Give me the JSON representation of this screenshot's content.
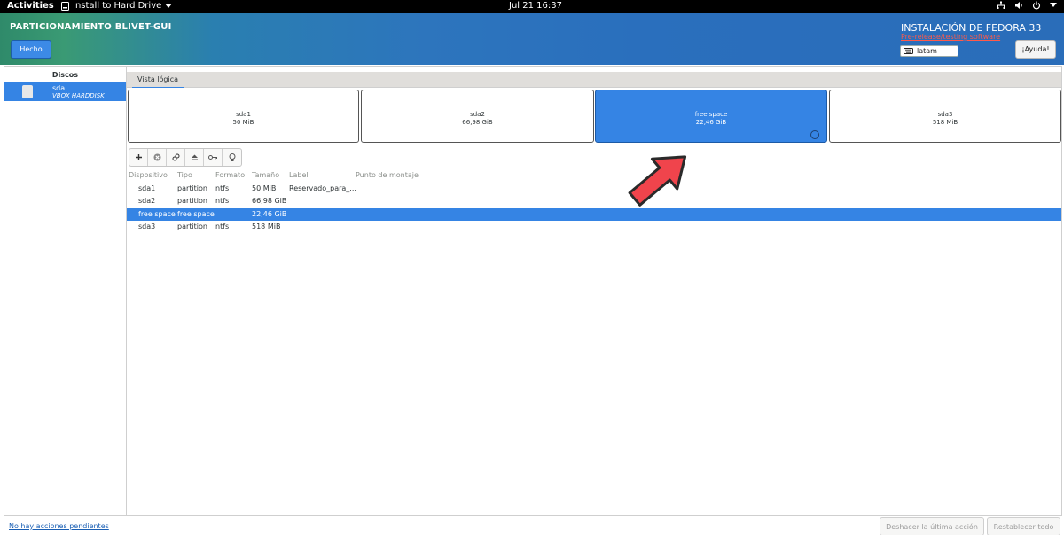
{
  "topbar": {
    "activities": "Activities",
    "app_menu": "Install to Hard Drive",
    "clock": "Jul 21  16:37"
  },
  "header": {
    "title": "PARTICIONAMIENTO BLIVET-GUI",
    "done_label": "Hecho",
    "install_title": "INSTALACIÓN DE FEDORA 33",
    "warning": "Pre-release/testing software",
    "keyboard": "latam",
    "help_label": "¡Ayuda!"
  },
  "disks": {
    "header": "Discos",
    "items": [
      {
        "name": "sda",
        "model": "VBOX HARDDISK"
      }
    ]
  },
  "view": {
    "tab_label": "Vista lógica",
    "blocks": [
      {
        "name": "sda1",
        "size": "50 MiB",
        "selected": false
      },
      {
        "name": "sda2",
        "size": "66,98 GiB",
        "selected": false
      },
      {
        "name": "free space",
        "size": "22,46 GiB",
        "selected": true
      },
      {
        "name": "sda3",
        "size": "518 MiB",
        "selected": false
      }
    ]
  },
  "toolbar": {
    "icons": [
      "add-icon",
      "delete-icon",
      "edit-icon",
      "unmount-icon",
      "decrypt-icon",
      "info-icon"
    ]
  },
  "table": {
    "columns": [
      "Dispositivo",
      "Tipo",
      "Formato",
      "Tamaño",
      "Label",
      "Punto de montaje"
    ],
    "rows": [
      {
        "device": "sda1",
        "type": "partition",
        "format": "ntfs",
        "size": "50 MiB",
        "label": "Reservado_para_...",
        "mount": "",
        "selected": false
      },
      {
        "device": "sda2",
        "type": "partition",
        "format": "ntfs",
        "size": "66,98 GiB",
        "label": "",
        "mount": "",
        "selected": false
      },
      {
        "device": "free space",
        "type": "free space",
        "format": "",
        "size": "22,46 GiB",
        "label": "",
        "mount": "",
        "selected": true
      },
      {
        "device": "sda3",
        "type": "partition",
        "format": "ntfs",
        "size": "518 MiB",
        "label": "",
        "mount": "",
        "selected": false
      }
    ]
  },
  "footer": {
    "pending": "No hay acciones pendientes",
    "undo_label": "Deshacer la última acción",
    "reset_label": "Restablecer todo"
  },
  "colors": {
    "accent": "#3584e4",
    "arrow": "#f0444c"
  }
}
